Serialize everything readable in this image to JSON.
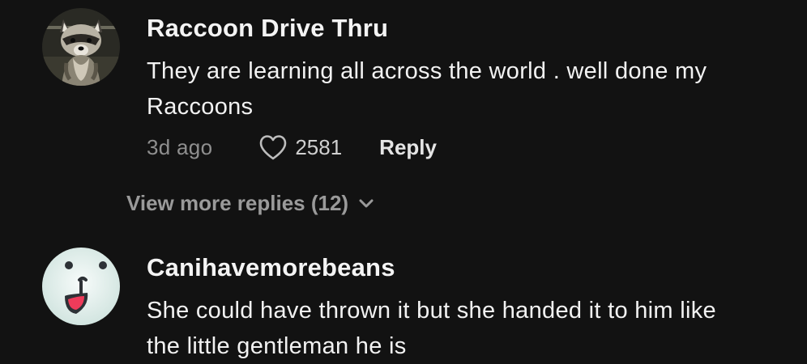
{
  "comments": [
    {
      "username": "Raccoon Drive Thru",
      "avatar_icon": "raccoon-avatar-icon",
      "text_lines": [
        "They are learning all across the world . well done my",
        "Raccoons"
      ],
      "timestamp": "3d ago",
      "likes": "2581",
      "reply_label": "Reply",
      "view_more": "View more replies (12)"
    },
    {
      "username": "Canihavemorebeans",
      "avatar_icon": "seal-avatar-icon",
      "text_lines": [
        "She could have thrown it but she handed it to him like",
        "the little gentleman he is"
      ]
    }
  ],
  "icons": {
    "like": "heart-icon",
    "expand": "chevron-down-icon"
  },
  "colors": {
    "background": "#121212",
    "username": "#f4f4f4",
    "muted": "#8f8f8f"
  }
}
